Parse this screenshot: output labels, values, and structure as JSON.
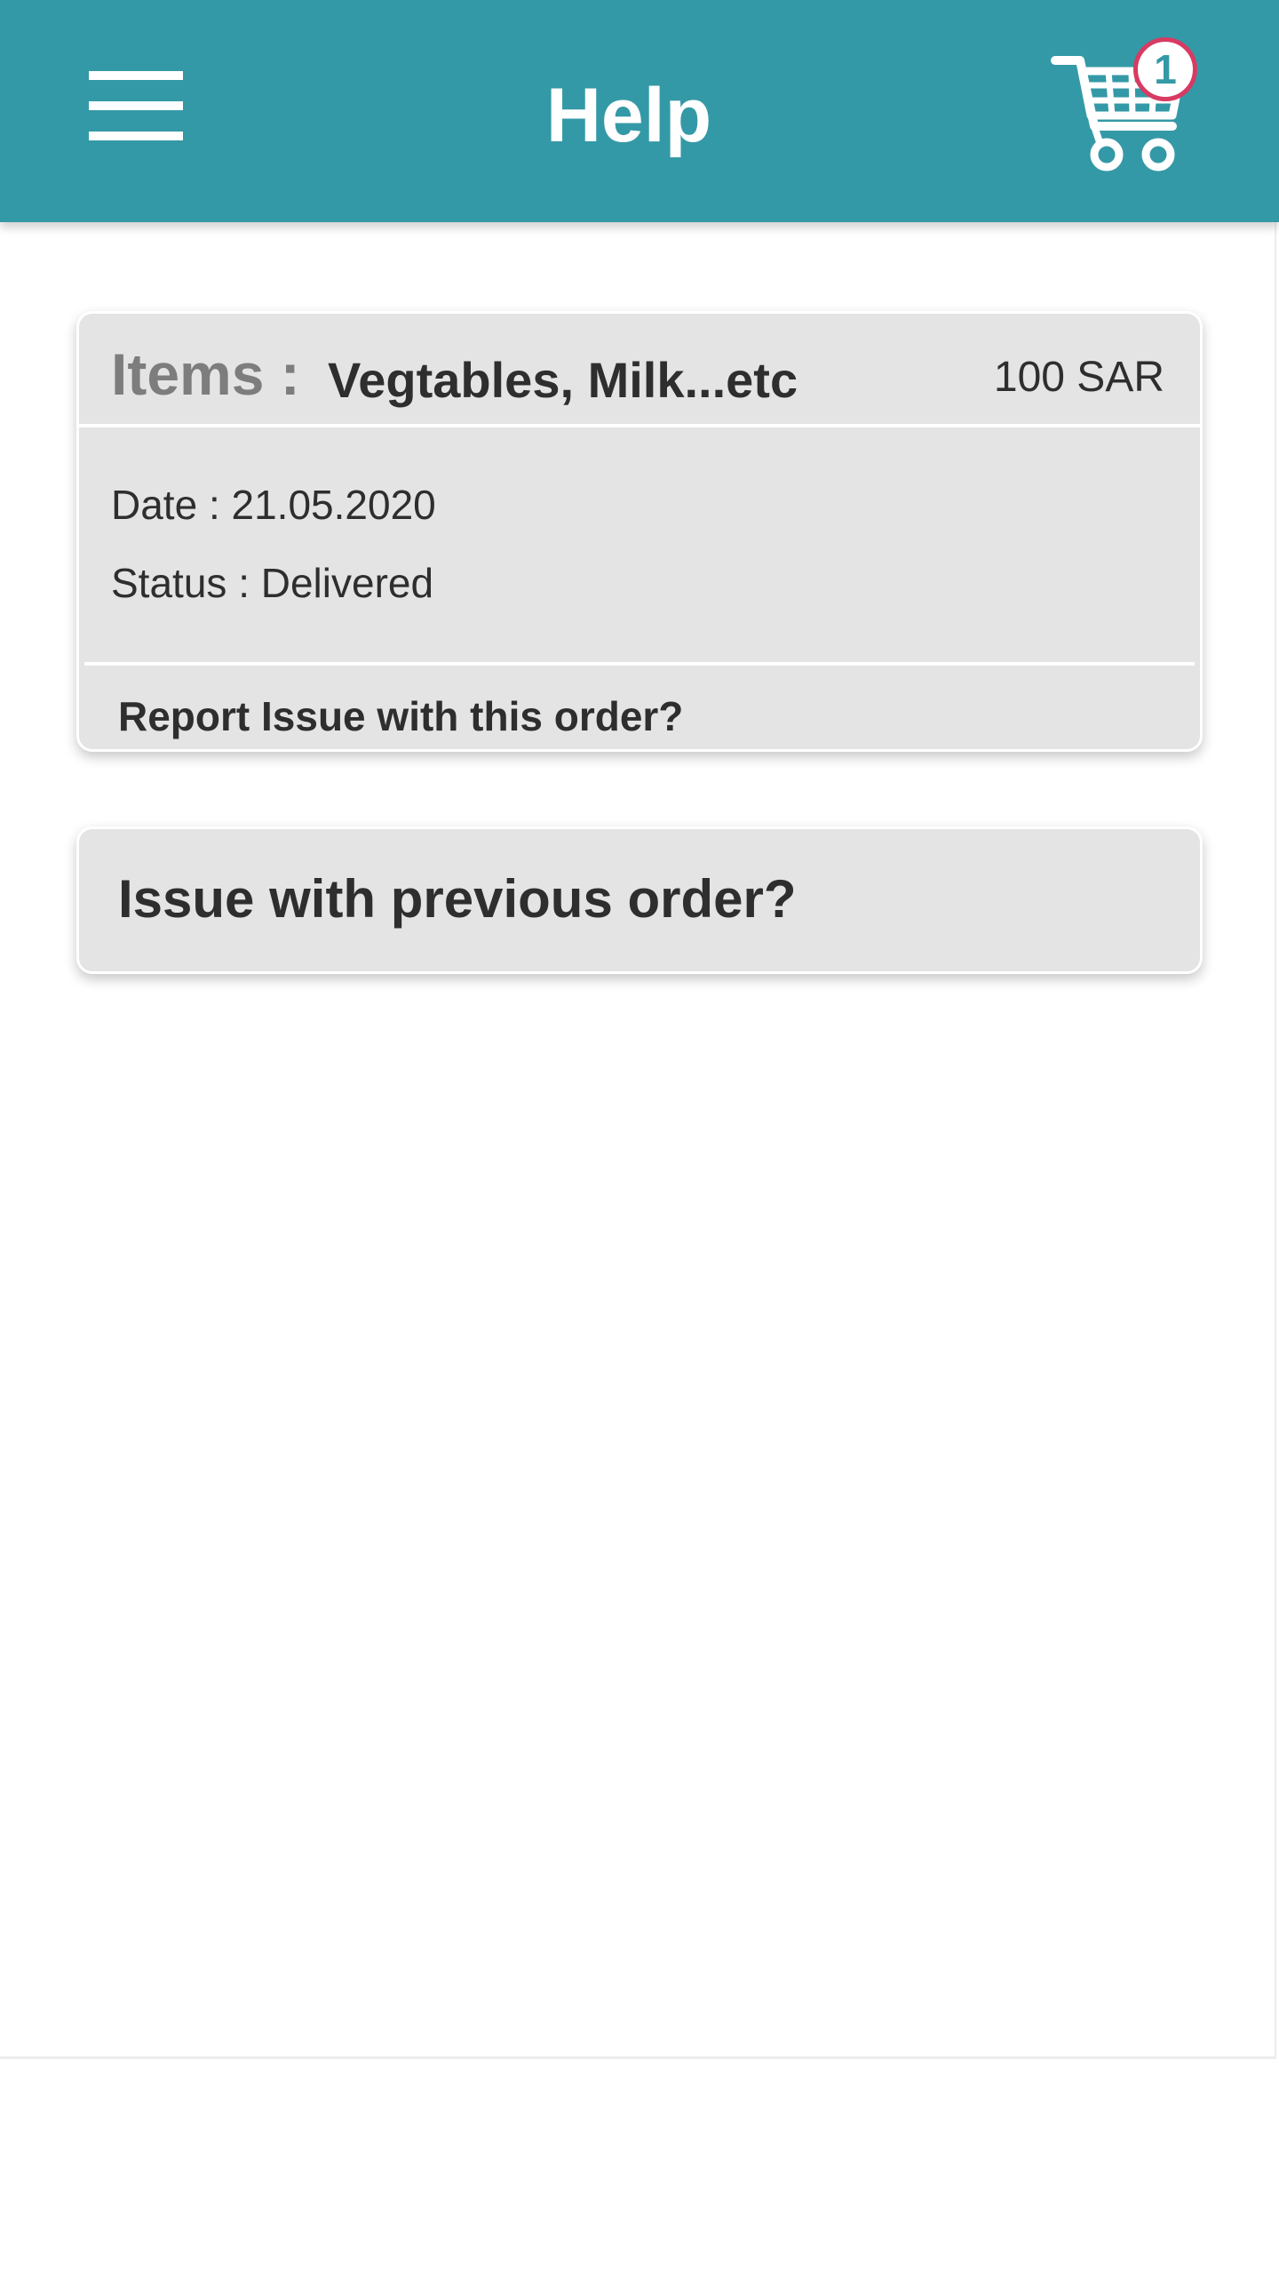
{
  "header": {
    "title": "Help",
    "menu_icon": "hamburger-menu-icon",
    "cart_icon": "shopping-cart-icon",
    "cart_count": "1",
    "background_color": "#3499a6",
    "badge_border_color": "#d83a63"
  },
  "order": {
    "items_label": "Items :",
    "items_value": "Vegtables, Milk...etc",
    "price": "100 SAR",
    "date": "Date : 21.05.2020",
    "status": "Status : Delivered",
    "report_link": "Report Issue with this order?"
  },
  "previous_order": {
    "label": "Issue with previous order?"
  }
}
